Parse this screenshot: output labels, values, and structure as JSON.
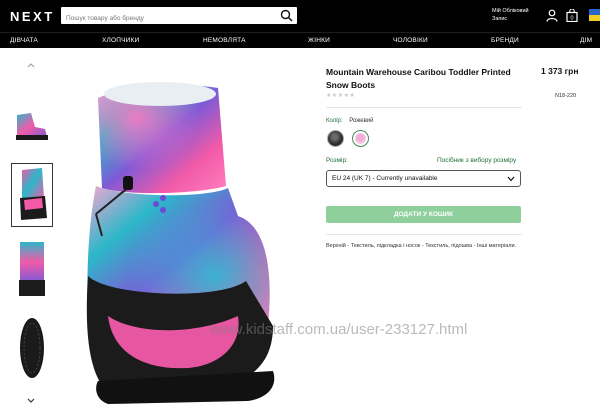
{
  "header": {
    "logo": "NEXT",
    "search_placeholder": "Пошук товару або бренду",
    "account_line1": "Мій Обліковий",
    "account_line2": "Запис",
    "bag_count": "0"
  },
  "nav": {
    "items": [
      "ДІВЧАТА",
      "ХЛОПЧИКИ",
      "НЕМОВЛЯТА",
      "ЖІНКИ",
      "ЧОЛОВІКИ",
      "БРЕНДИ",
      "ДІМ"
    ]
  },
  "gallery": {
    "watermark": "www.kidstaff.com.ua/user-233127.html"
  },
  "product": {
    "title": "Mountain Warehouse Caribou Toddler Printed Snow Boots",
    "price": "1 373 грн",
    "rating_stars": "★★★★★",
    "code": "N18-220",
    "color_label": "Колір:",
    "color_value": "Рожевий",
    "size_label": "Розмір:",
    "size_guide": "Посібник з вибору розміру",
    "size_selected": "EU 24 (UK 7) - Currently unavailable",
    "add_button": "ДОДАТИ У КОШИК",
    "composition": "Верхній - Текстиль, підкладка і носок - Текстиль, підошва - Інші матеріали."
  },
  "colors": {
    "header_bg": "#000000",
    "accent_green": "#1f6f3a",
    "button_green": "#8fcf9b",
    "boot_pink": "#f25aa8",
    "boot_teal": "#2bb7c9",
    "boot_purple": "#7f5ad6"
  }
}
